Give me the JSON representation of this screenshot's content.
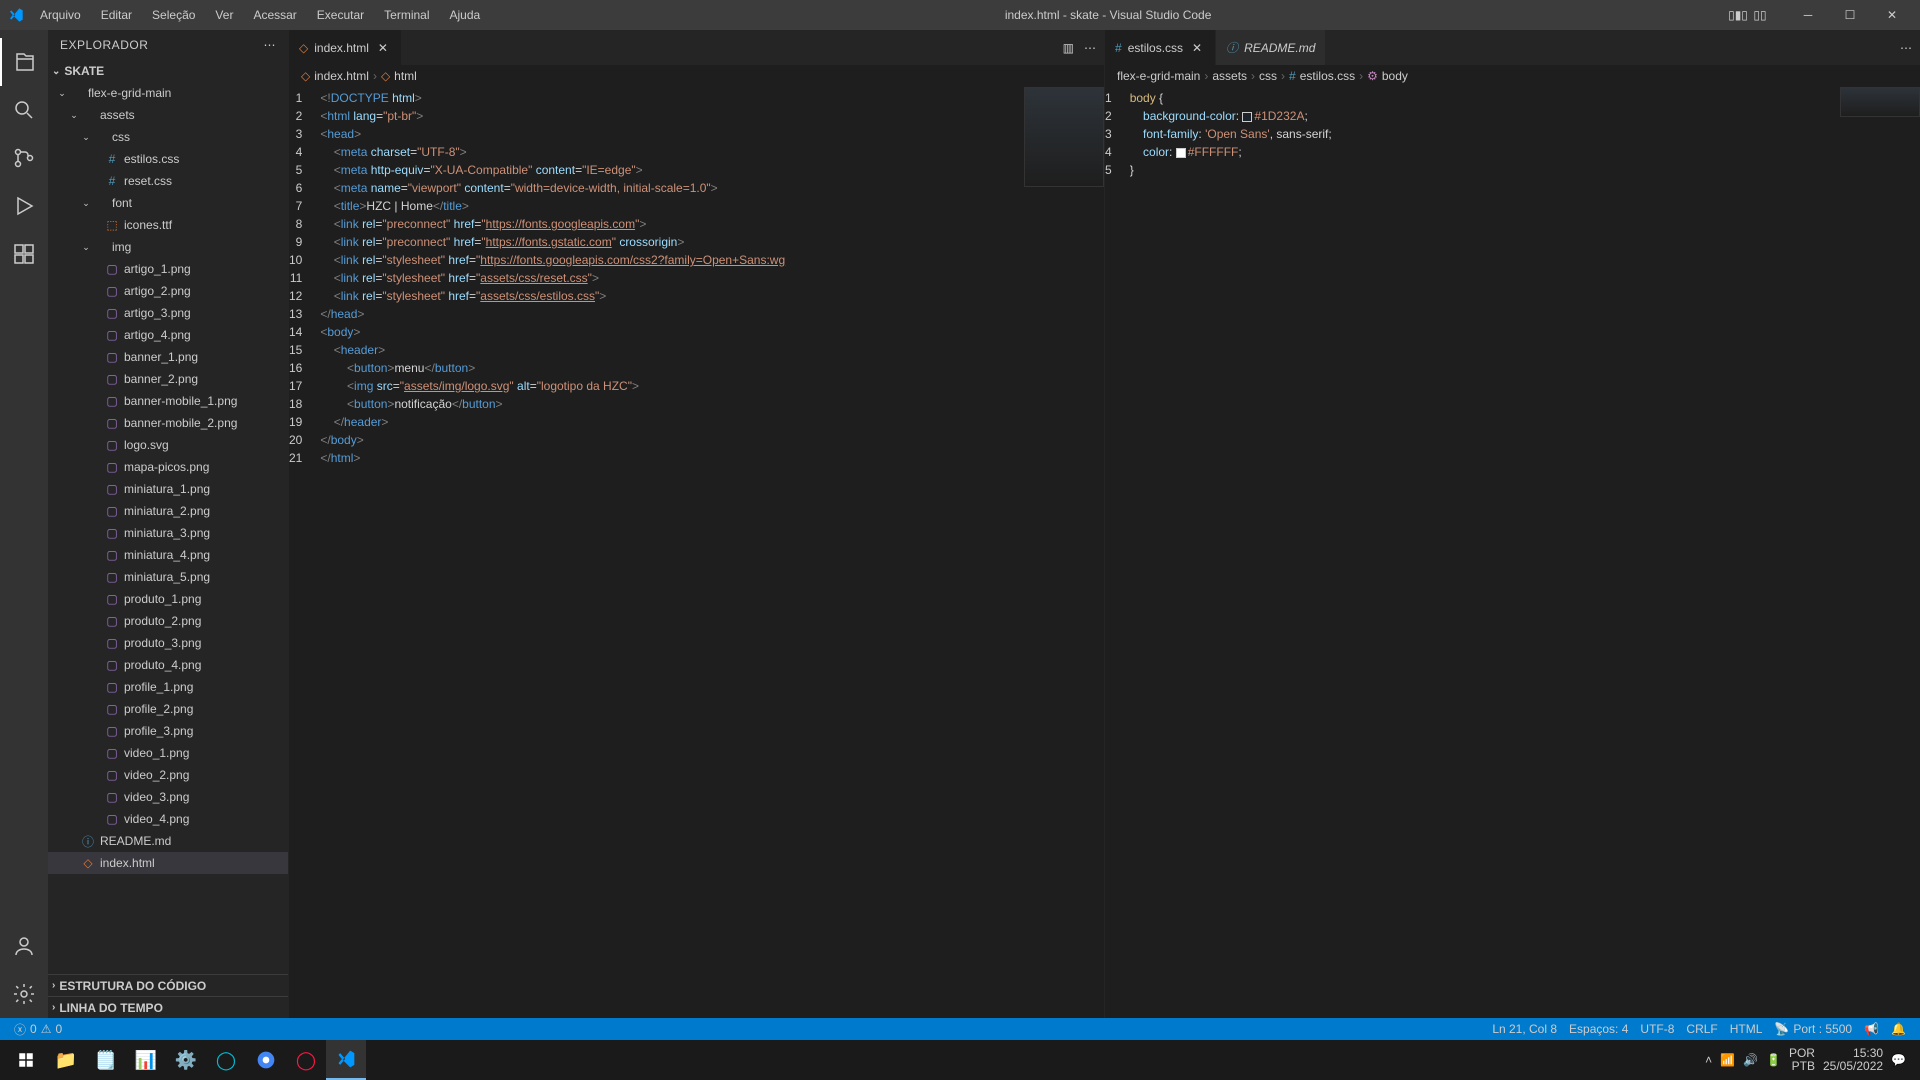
{
  "window_title": "index.html - skate - Visual Studio Code",
  "menu": [
    "Arquivo",
    "Editar",
    "Seleção",
    "Ver",
    "Acessar",
    "Executar",
    "Terminal",
    "Ajuda"
  ],
  "sidebar": {
    "title": "EXPLORADOR",
    "project": "SKATE",
    "sections_bottom": [
      "ESTRUTURA DO CÓDIGO",
      "LINHA DO TEMPO"
    ],
    "tree": [
      {
        "label": "flex-e-grid-main",
        "type": "folder",
        "indent": 0,
        "open": true
      },
      {
        "label": "assets",
        "type": "folder",
        "indent": 1,
        "open": true
      },
      {
        "label": "css",
        "type": "folder",
        "indent": 2,
        "open": true
      },
      {
        "label": "estilos.css",
        "type": "css",
        "indent": 3
      },
      {
        "label": "reset.css",
        "type": "css",
        "indent": 3
      },
      {
        "label": "font",
        "type": "folder",
        "indent": 2,
        "open": true
      },
      {
        "label": "icones.ttf",
        "type": "font2",
        "indent": 3
      },
      {
        "label": "img",
        "type": "folder",
        "indent": 2,
        "open": true
      },
      {
        "label": "artigo_1.png",
        "type": "img",
        "indent": 3
      },
      {
        "label": "artigo_2.png",
        "type": "img",
        "indent": 3
      },
      {
        "label": "artigo_3.png",
        "type": "img",
        "indent": 3
      },
      {
        "label": "artigo_4.png",
        "type": "img",
        "indent": 3
      },
      {
        "label": "banner_1.png",
        "type": "img",
        "indent": 3
      },
      {
        "label": "banner_2.png",
        "type": "img",
        "indent": 3
      },
      {
        "label": "banner-mobile_1.png",
        "type": "img",
        "indent": 3
      },
      {
        "label": "banner-mobile_2.png",
        "type": "img",
        "indent": 3
      },
      {
        "label": "logo.svg",
        "type": "img",
        "indent": 3
      },
      {
        "label": "mapa-picos.png",
        "type": "img",
        "indent": 3
      },
      {
        "label": "miniatura_1.png",
        "type": "img",
        "indent": 3
      },
      {
        "label": "miniatura_2.png",
        "type": "img",
        "indent": 3
      },
      {
        "label": "miniatura_3.png",
        "type": "img",
        "indent": 3
      },
      {
        "label": "miniatura_4.png",
        "type": "img",
        "indent": 3
      },
      {
        "label": "miniatura_5.png",
        "type": "img",
        "indent": 3
      },
      {
        "label": "produto_1.png",
        "type": "img",
        "indent": 3
      },
      {
        "label": "produto_2.png",
        "type": "img",
        "indent": 3
      },
      {
        "label": "produto_3.png",
        "type": "img",
        "indent": 3
      },
      {
        "label": "produto_4.png",
        "type": "img",
        "indent": 3
      },
      {
        "label": "profile_1.png",
        "type": "img",
        "indent": 3
      },
      {
        "label": "profile_2.png",
        "type": "img",
        "indent": 3
      },
      {
        "label": "profile_3.png",
        "type": "img",
        "indent": 3
      },
      {
        "label": "video_1.png",
        "type": "img",
        "indent": 3
      },
      {
        "label": "video_2.png",
        "type": "img",
        "indent": 3
      },
      {
        "label": "video_3.png",
        "type": "img",
        "indent": 3
      },
      {
        "label": "video_4.png",
        "type": "img",
        "indent": 3
      },
      {
        "label": "README.md",
        "type": "md",
        "indent": 1
      },
      {
        "label": "index.html",
        "type": "html",
        "indent": 1,
        "selected": true
      }
    ]
  },
  "left_editor": {
    "tab": "index.html",
    "breadcrumb": [
      "index.html",
      "html"
    ],
    "lines": [
      [
        {
          "t": "<!",
          "c": "punc"
        },
        {
          "t": "DOCTYPE",
          "c": "doc"
        },
        {
          "t": " ",
          "c": "txt"
        },
        {
          "t": "html",
          "c": "attr"
        },
        {
          "t": ">",
          "c": "punc"
        }
      ],
      [
        {
          "t": "<",
          "c": "punc"
        },
        {
          "t": "html",
          "c": "tag"
        },
        {
          "t": " ",
          "c": "txt"
        },
        {
          "t": "lang",
          "c": "attr"
        },
        {
          "t": "=",
          "c": "txt"
        },
        {
          "t": "\"pt-br\"",
          "c": "str"
        },
        {
          "t": ">",
          "c": "punc"
        }
      ],
      [
        {
          "t": "<",
          "c": "punc"
        },
        {
          "t": "head",
          "c": "tag"
        },
        {
          "t": ">",
          "c": "punc"
        }
      ],
      [
        {
          "t": "    <",
          "c": "punc"
        },
        {
          "t": "meta",
          "c": "tag"
        },
        {
          "t": " ",
          "c": "txt"
        },
        {
          "t": "charset",
          "c": "attr"
        },
        {
          "t": "=",
          "c": "txt"
        },
        {
          "t": "\"UTF-8\"",
          "c": "str"
        },
        {
          "t": ">",
          "c": "punc"
        }
      ],
      [
        {
          "t": "    <",
          "c": "punc"
        },
        {
          "t": "meta",
          "c": "tag"
        },
        {
          "t": " ",
          "c": "txt"
        },
        {
          "t": "http-equiv",
          "c": "attr"
        },
        {
          "t": "=",
          "c": "txt"
        },
        {
          "t": "\"X-UA-Compatible\"",
          "c": "str"
        },
        {
          "t": " ",
          "c": "txt"
        },
        {
          "t": "content",
          "c": "attr"
        },
        {
          "t": "=",
          "c": "txt"
        },
        {
          "t": "\"IE=edge\"",
          "c": "str"
        },
        {
          "t": ">",
          "c": "punc"
        }
      ],
      [
        {
          "t": "    <",
          "c": "punc"
        },
        {
          "t": "meta",
          "c": "tag"
        },
        {
          "t": " ",
          "c": "txt"
        },
        {
          "t": "name",
          "c": "attr"
        },
        {
          "t": "=",
          "c": "txt"
        },
        {
          "t": "\"viewport\"",
          "c": "str"
        },
        {
          "t": " ",
          "c": "txt"
        },
        {
          "t": "content",
          "c": "attr"
        },
        {
          "t": "=",
          "c": "txt"
        },
        {
          "t": "\"width=device-width, initial-scale=1.0\"",
          "c": "str"
        },
        {
          "t": ">",
          "c": "punc"
        }
      ],
      [
        {
          "t": "    <",
          "c": "punc"
        },
        {
          "t": "title",
          "c": "tag"
        },
        {
          "t": ">",
          "c": "punc"
        },
        {
          "t": "HZC | Home",
          "c": "txt"
        },
        {
          "t": "</",
          "c": "punc"
        },
        {
          "t": "title",
          "c": "tag"
        },
        {
          "t": ">",
          "c": "punc"
        }
      ],
      [
        {
          "t": "    <",
          "c": "punc"
        },
        {
          "t": "link",
          "c": "tag"
        },
        {
          "t": " ",
          "c": "txt"
        },
        {
          "t": "rel",
          "c": "attr"
        },
        {
          "t": "=",
          "c": "txt"
        },
        {
          "t": "\"preconnect\"",
          "c": "str"
        },
        {
          "t": " ",
          "c": "txt"
        },
        {
          "t": "href",
          "c": "attr"
        },
        {
          "t": "=",
          "c": "txt"
        },
        {
          "t": "\"",
          "c": "str"
        },
        {
          "t": "https://fonts.googleapis.com",
          "c": "url"
        },
        {
          "t": "\"",
          "c": "str"
        },
        {
          "t": ">",
          "c": "punc"
        }
      ],
      [
        {
          "t": "    <",
          "c": "punc"
        },
        {
          "t": "link",
          "c": "tag"
        },
        {
          "t": " ",
          "c": "txt"
        },
        {
          "t": "rel",
          "c": "attr"
        },
        {
          "t": "=",
          "c": "txt"
        },
        {
          "t": "\"preconnect\"",
          "c": "str"
        },
        {
          "t": " ",
          "c": "txt"
        },
        {
          "t": "href",
          "c": "attr"
        },
        {
          "t": "=",
          "c": "txt"
        },
        {
          "t": "\"",
          "c": "str"
        },
        {
          "t": "https://fonts.gstatic.com",
          "c": "url"
        },
        {
          "t": "\"",
          "c": "str"
        },
        {
          "t": " ",
          "c": "txt"
        },
        {
          "t": "crossorigin",
          "c": "attr"
        },
        {
          "t": ">",
          "c": "punc"
        }
      ],
      [
        {
          "t": "    <",
          "c": "punc"
        },
        {
          "t": "link",
          "c": "tag"
        },
        {
          "t": " ",
          "c": "txt"
        },
        {
          "t": "rel",
          "c": "attr"
        },
        {
          "t": "=",
          "c": "txt"
        },
        {
          "t": "\"stylesheet\"",
          "c": "str"
        },
        {
          "t": " ",
          "c": "txt"
        },
        {
          "t": "href",
          "c": "attr"
        },
        {
          "t": "=",
          "c": "txt"
        },
        {
          "t": "\"",
          "c": "str"
        },
        {
          "t": "https://fonts.googleapis.com/css2?family=Open+Sans:wg",
          "c": "url"
        }
      ],
      [
        {
          "t": "    <",
          "c": "punc"
        },
        {
          "t": "link",
          "c": "tag"
        },
        {
          "t": " ",
          "c": "txt"
        },
        {
          "t": "rel",
          "c": "attr"
        },
        {
          "t": "=",
          "c": "txt"
        },
        {
          "t": "\"stylesheet\"",
          "c": "str"
        },
        {
          "t": " ",
          "c": "txt"
        },
        {
          "t": "href",
          "c": "attr"
        },
        {
          "t": "=",
          "c": "txt"
        },
        {
          "t": "\"",
          "c": "str"
        },
        {
          "t": "assets/css/reset.css",
          "c": "url"
        },
        {
          "t": "\"",
          "c": "str"
        },
        {
          "t": ">",
          "c": "punc"
        }
      ],
      [
        {
          "t": "    <",
          "c": "punc"
        },
        {
          "t": "link",
          "c": "tag"
        },
        {
          "t": " ",
          "c": "txt"
        },
        {
          "t": "rel",
          "c": "attr"
        },
        {
          "t": "=",
          "c": "txt"
        },
        {
          "t": "\"stylesheet\"",
          "c": "str"
        },
        {
          "t": " ",
          "c": "txt"
        },
        {
          "t": "href",
          "c": "attr"
        },
        {
          "t": "=",
          "c": "txt"
        },
        {
          "t": "\"",
          "c": "str"
        },
        {
          "t": "assets/css/estilos.css",
          "c": "url"
        },
        {
          "t": "\"",
          "c": "str"
        },
        {
          "t": ">",
          "c": "punc"
        }
      ],
      [
        {
          "t": "</",
          "c": "punc"
        },
        {
          "t": "head",
          "c": "tag"
        },
        {
          "t": ">",
          "c": "punc"
        }
      ],
      [
        {
          "t": "<",
          "c": "punc"
        },
        {
          "t": "body",
          "c": "tag"
        },
        {
          "t": ">",
          "c": "punc"
        }
      ],
      [
        {
          "t": "    <",
          "c": "punc"
        },
        {
          "t": "header",
          "c": "tag"
        },
        {
          "t": ">",
          "c": "punc"
        }
      ],
      [
        {
          "t": "        <",
          "c": "punc"
        },
        {
          "t": "button",
          "c": "tag"
        },
        {
          "t": ">",
          "c": "punc"
        },
        {
          "t": "menu",
          "c": "txt"
        },
        {
          "t": "</",
          "c": "punc"
        },
        {
          "t": "button",
          "c": "tag"
        },
        {
          "t": ">",
          "c": "punc"
        }
      ],
      [
        {
          "t": "        <",
          "c": "punc"
        },
        {
          "t": "img",
          "c": "tag"
        },
        {
          "t": " ",
          "c": "txt"
        },
        {
          "t": "src",
          "c": "attr"
        },
        {
          "t": "=",
          "c": "txt"
        },
        {
          "t": "\"",
          "c": "str"
        },
        {
          "t": "assets/img/logo.svg",
          "c": "url"
        },
        {
          "t": "\"",
          "c": "str"
        },
        {
          "t": " ",
          "c": "txt"
        },
        {
          "t": "alt",
          "c": "attr"
        },
        {
          "t": "=",
          "c": "txt"
        },
        {
          "t": "\"logotipo da HZC\"",
          "c": "str"
        },
        {
          "t": ">",
          "c": "punc"
        }
      ],
      [
        {
          "t": "        <",
          "c": "punc"
        },
        {
          "t": "button",
          "c": "tag"
        },
        {
          "t": ">",
          "c": "punc"
        },
        {
          "t": "notificação",
          "c": "txt"
        },
        {
          "t": "</",
          "c": "punc"
        },
        {
          "t": "button",
          "c": "tag"
        },
        {
          "t": ">",
          "c": "punc"
        }
      ],
      [
        {
          "t": "    </",
          "c": "punc"
        },
        {
          "t": "header",
          "c": "tag"
        },
        {
          "t": ">",
          "c": "punc"
        }
      ],
      [
        {
          "t": "</",
          "c": "punc"
        },
        {
          "t": "body",
          "c": "tag"
        },
        {
          "t": ">",
          "c": "punc"
        }
      ],
      [
        {
          "t": "</",
          "c": "punc"
        },
        {
          "t": "html",
          "c": "tag"
        },
        {
          "t": ">",
          "c": "punc"
        }
      ]
    ]
  },
  "right_editor": {
    "tabs": [
      {
        "label": "estilos.css",
        "active": true
      },
      {
        "label": "README.md",
        "active": false,
        "italic": true
      }
    ],
    "breadcrumb": [
      "flex-e-grid-main",
      "assets",
      "css",
      "estilos.css",
      "body"
    ],
    "lines": [
      [
        {
          "t": "body",
          "c": "sel"
        },
        {
          "t": " {",
          "c": "txt"
        }
      ],
      [
        {
          "t": "    ",
          "c": "txt"
        },
        {
          "t": "background-color",
          "c": "prop"
        },
        {
          "t": ": ",
          "c": "txt"
        },
        {
          "sw": "#1D232A"
        },
        {
          "t": "#1D232A",
          "c": "val"
        },
        {
          "t": ";",
          "c": "txt"
        }
      ],
      [
        {
          "t": "    ",
          "c": "txt"
        },
        {
          "t": "font-family",
          "c": "prop"
        },
        {
          "t": ": ",
          "c": "txt"
        },
        {
          "t": "'Open Sans'",
          "c": "val"
        },
        {
          "t": ", sans-serif;",
          "c": "txt"
        }
      ],
      [
        {
          "t": "    ",
          "c": "txt"
        },
        {
          "t": "color",
          "c": "prop"
        },
        {
          "t": ": ",
          "c": "txt"
        },
        {
          "sw": "#FFFFFF"
        },
        {
          "t": "#FFFFFF",
          "c": "val"
        },
        {
          "t": ";",
          "c": "txt"
        }
      ],
      [
        {
          "t": "}",
          "c": "txt"
        }
      ]
    ]
  },
  "statusbar": {
    "errors": "0",
    "warnings": "0",
    "pos": "Ln 21, Col 8",
    "spaces": "Espaços: 4",
    "enc": "UTF-8",
    "eol": "CRLF",
    "lang": "HTML",
    "port": "Port : 5500"
  },
  "tray": {
    "lang1": "POR",
    "lang2": "PTB",
    "time": "15:30",
    "date": "25/05/2022"
  }
}
